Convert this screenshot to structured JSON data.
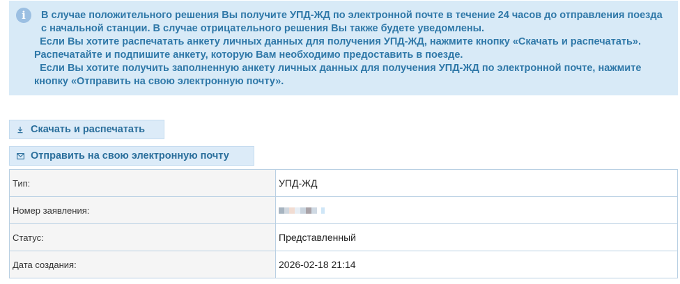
{
  "colors": {
    "info_background": "#d8eaf7",
    "info_text": "#2f78a8",
    "button_background": "#dcebf8",
    "button_text": "#2b6f9c",
    "table_border": "#b9d0e3",
    "label_background": "#f5f5f5"
  },
  "info": {
    "icon": "info-icon",
    "paragraphs": [
      "В случае положительного решения Вы получите УПД-ЖД по электронной почте в течение 24 часов до отправления поезда с начальной станции. В случае отрицательного решения Вы также будете уведомлены.",
      "  Если Вы хотите распечатать анкету личных данных для получения УПД-ЖД, нажмите кнопку «Скачать и распечатать». Распечатайте и подпишите анкету, которую Вам необходимо предоставить в поезде.",
      "  Если Вы хотите получить заполненную анкету личных данных для получения УПД-ЖД по электронной почте, нажмите кнопку «Отправить на свою электронную почту»."
    ]
  },
  "buttons": {
    "download": {
      "label": "Скачать и распечатать",
      "icon": "download-icon"
    },
    "email": {
      "label": "Отправить на свою электронную почту",
      "icon": "envelope-icon"
    }
  },
  "details": {
    "rows": [
      {
        "label": "Тип:",
        "value": "УПД-ЖД"
      },
      {
        "label": "Номер заявления:",
        "value": ""
      },
      {
        "label": "Статус:",
        "value": "Представленный"
      },
      {
        "label": "Дата создания:",
        "value": "2026-02-18 21:14"
      }
    ]
  }
}
